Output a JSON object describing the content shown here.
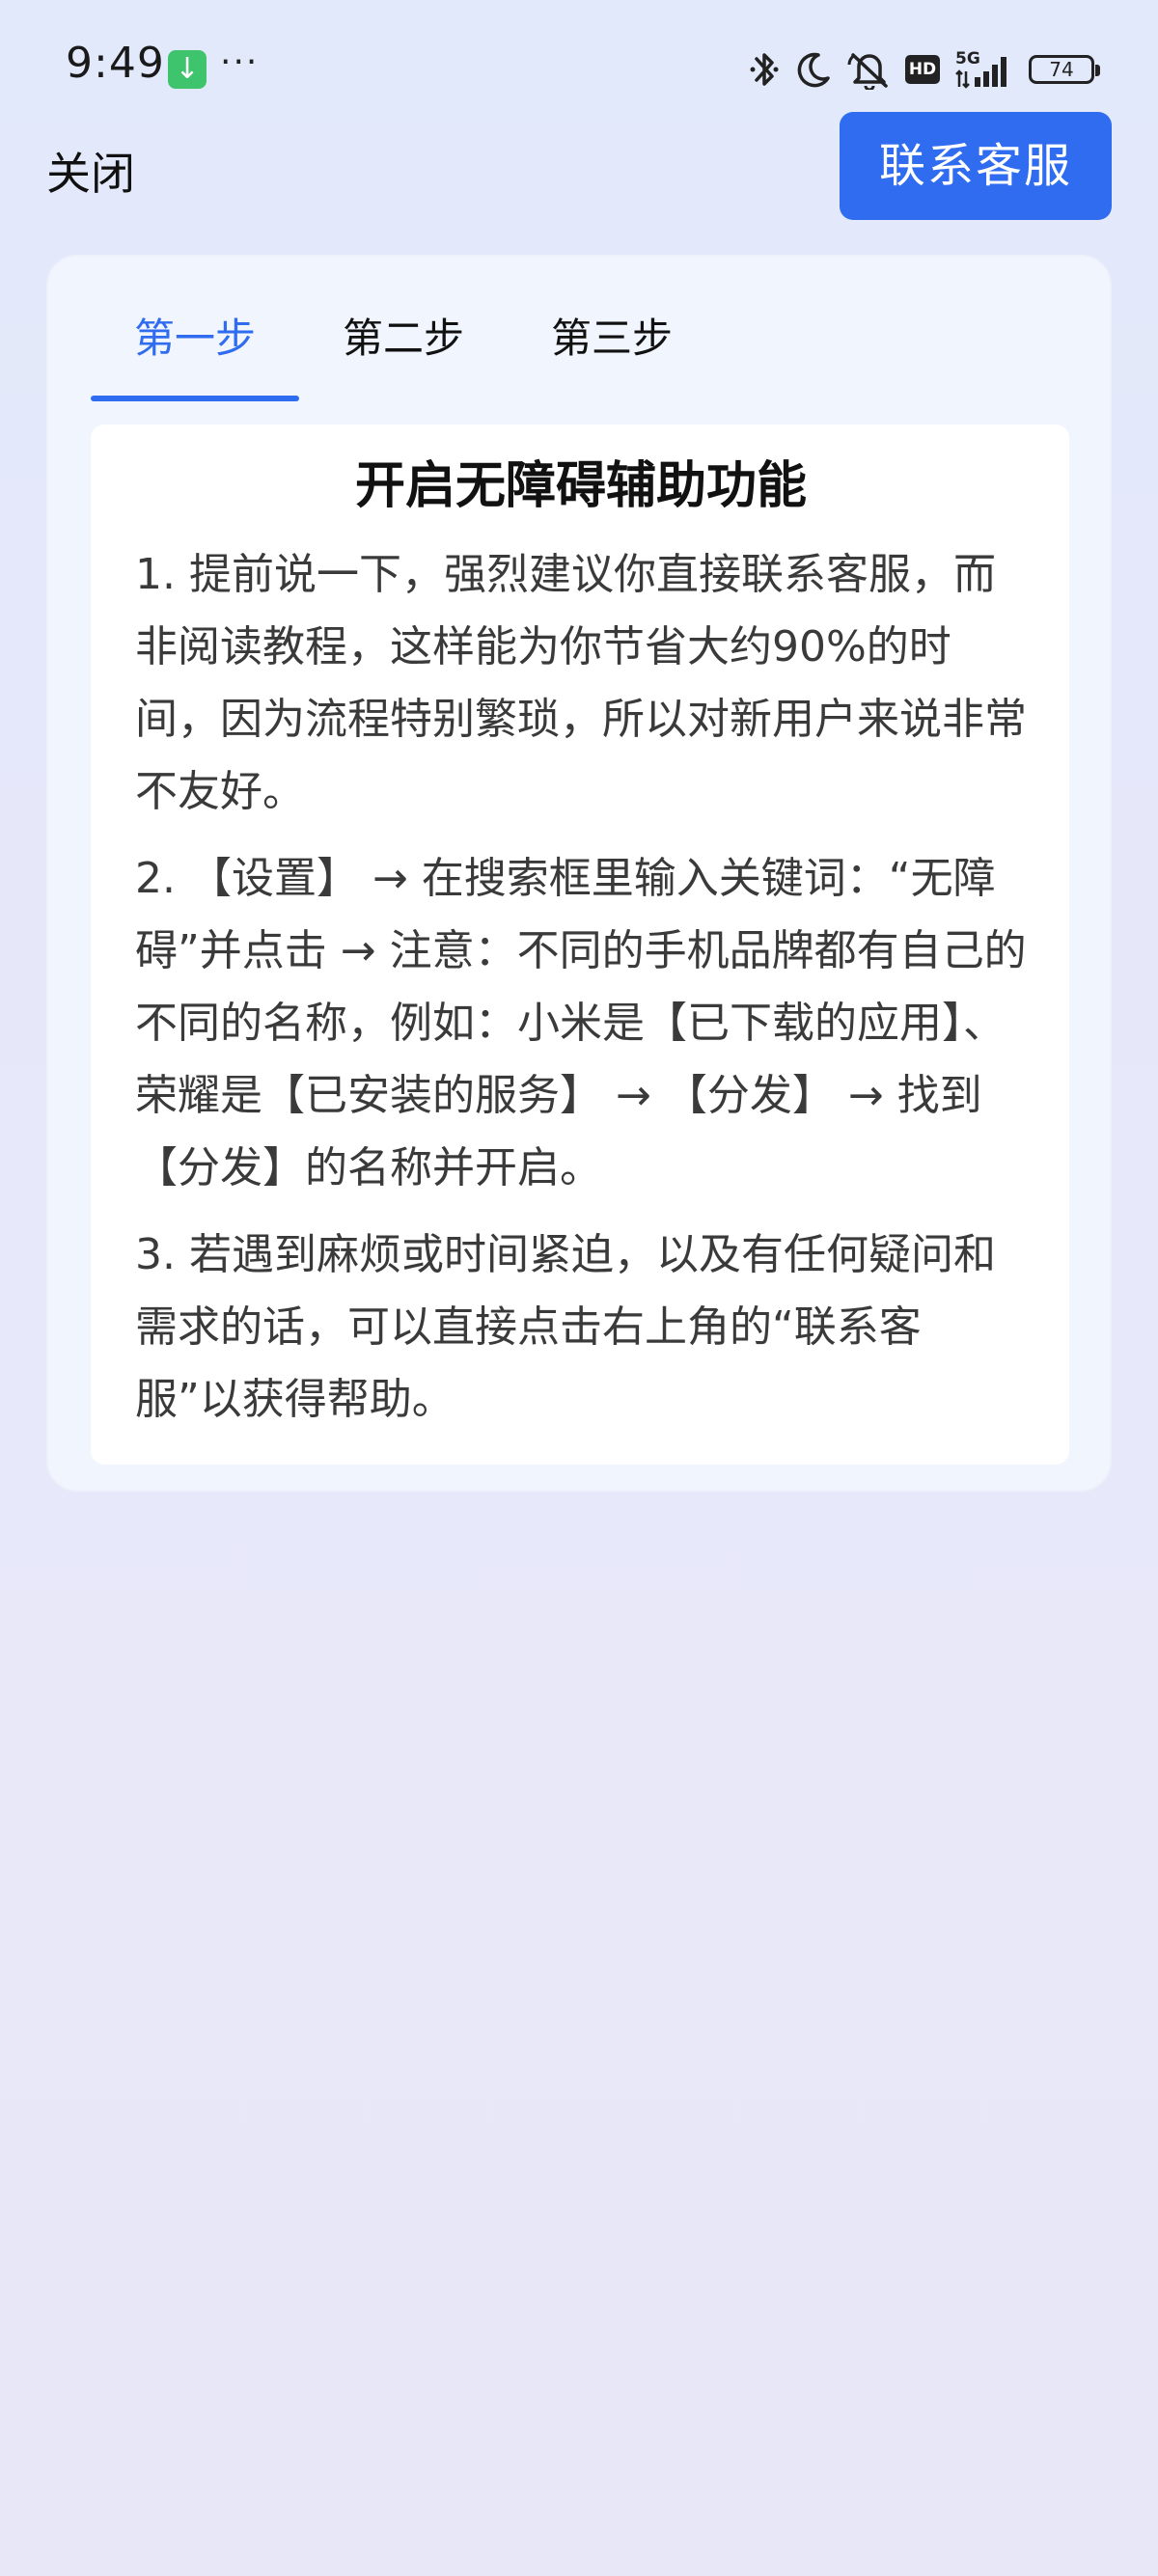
{
  "status_bar": {
    "time": "9:49",
    "dots": "···",
    "network": "5G",
    "hd": "HD",
    "battery": "74"
  },
  "header": {
    "close_label": "关闭",
    "contact_label": "联系客服"
  },
  "tabs": [
    {
      "label": "第一步"
    },
    {
      "label": "第二步"
    },
    {
      "label": "第三步"
    }
  ],
  "content": {
    "title": "开启无障碍辅助功能",
    "paragraphs": [
      "1. 提前说一下，强烈建议你直接联系客服，而非阅读教程，这样能为你节省大约90%的时间，因为流程特别繁琐，所以对新用户来说非常不友好。",
      "2. 【设置】 → 在搜索框里输入关键词：“无障碍”并点击 → 注意：不同的手机品牌都有自己的不同的名称，例如：小米是【已下载的应用】、荣耀是【已安装的服务】 → 【分发】 → 找到【分发】的名称并开启。",
      "3. 若遇到麻烦或时间紧迫，以及有任何疑问和需求的话，可以直接点击右上角的“联系客服”以获得帮助。"
    ]
  },
  "colors": {
    "accent": "#2f6cf0",
    "background_top": "#e2e9fb",
    "background_bottom": "#e8e7f8"
  }
}
